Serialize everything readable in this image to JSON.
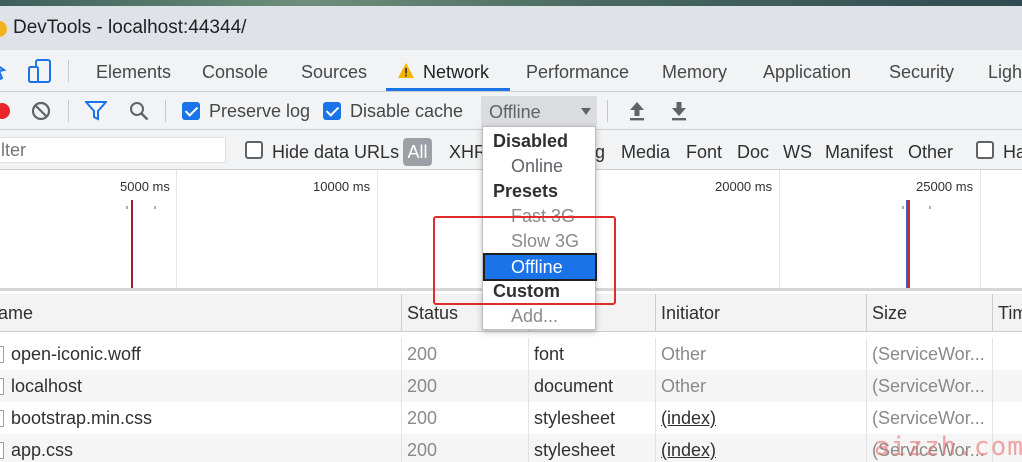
{
  "window": {
    "title": "DevTools - localhost:44344/"
  },
  "tabs": [
    {
      "label": "Elements"
    },
    {
      "label": "Console"
    },
    {
      "label": "Sources"
    },
    {
      "label": "Network",
      "warning": true
    },
    {
      "label": "Performance"
    },
    {
      "label": "Memory"
    },
    {
      "label": "Application"
    },
    {
      "label": "Security"
    },
    {
      "label": "Ligh"
    }
  ],
  "toolbar": {
    "preserve_log": {
      "label": "Preserve log",
      "checked": true
    },
    "disable_cache": {
      "label": "Disable cache",
      "checked": true
    },
    "throttling_value": "Offline"
  },
  "filterbar": {
    "filter_placeholder": "lter",
    "hide_data_urls": {
      "label": "Hide data URLs",
      "checked": false
    },
    "all_label": "All",
    "types": [
      "XHR",
      "g",
      "Media",
      "Font",
      "Doc",
      "WS",
      "Manifest",
      "Other"
    ],
    "has_label": "Ha"
  },
  "overview": {
    "ticks": [
      "5000 ms",
      "10000 ms",
      "20000 ms",
      "25000 ms"
    ]
  },
  "throttle_menu": {
    "groups": [
      {
        "label": "Disabled",
        "items": [
          {
            "label": "Online",
            "state": "normal"
          }
        ]
      },
      {
        "label": "Presets",
        "items": [
          {
            "label": "Fast 3G",
            "state": "disabled"
          },
          {
            "label": "Slow 3G",
            "state": "disabled"
          },
          {
            "label": "Offline",
            "state": "selected"
          }
        ]
      },
      {
        "label": "Custom",
        "items": [
          {
            "label": "Add...",
            "state": "disabled"
          }
        ]
      }
    ]
  },
  "table": {
    "columns": [
      "ame",
      "Status",
      "Initiator",
      "Size",
      "Tim"
    ],
    "rows": [
      {
        "name": "open-iconic.woff",
        "status": "200",
        "type": "font",
        "initiator": "Other",
        "initiator_link": false,
        "size": "(ServiceWor..."
      },
      {
        "name": "localhost",
        "status": "200",
        "type": "document",
        "initiator": "Other",
        "initiator_link": false,
        "size": "(ServiceWor..."
      },
      {
        "name": "bootstrap.min.css",
        "status": "200",
        "type": "stylesheet",
        "initiator": "(index)",
        "initiator_link": true,
        "size": "(ServiceWor..."
      },
      {
        "name": "app.css",
        "status": "200",
        "type": "stylesheet",
        "initiator": "(index)",
        "initiator_link": true,
        "size": "(ServiceWor..."
      }
    ]
  },
  "watermark": "aizzh.com",
  "colors": {
    "accent": "#1a73e8",
    "record": "#e8262b",
    "warning": "#f4b400",
    "annotation": "#e02b2b"
  }
}
